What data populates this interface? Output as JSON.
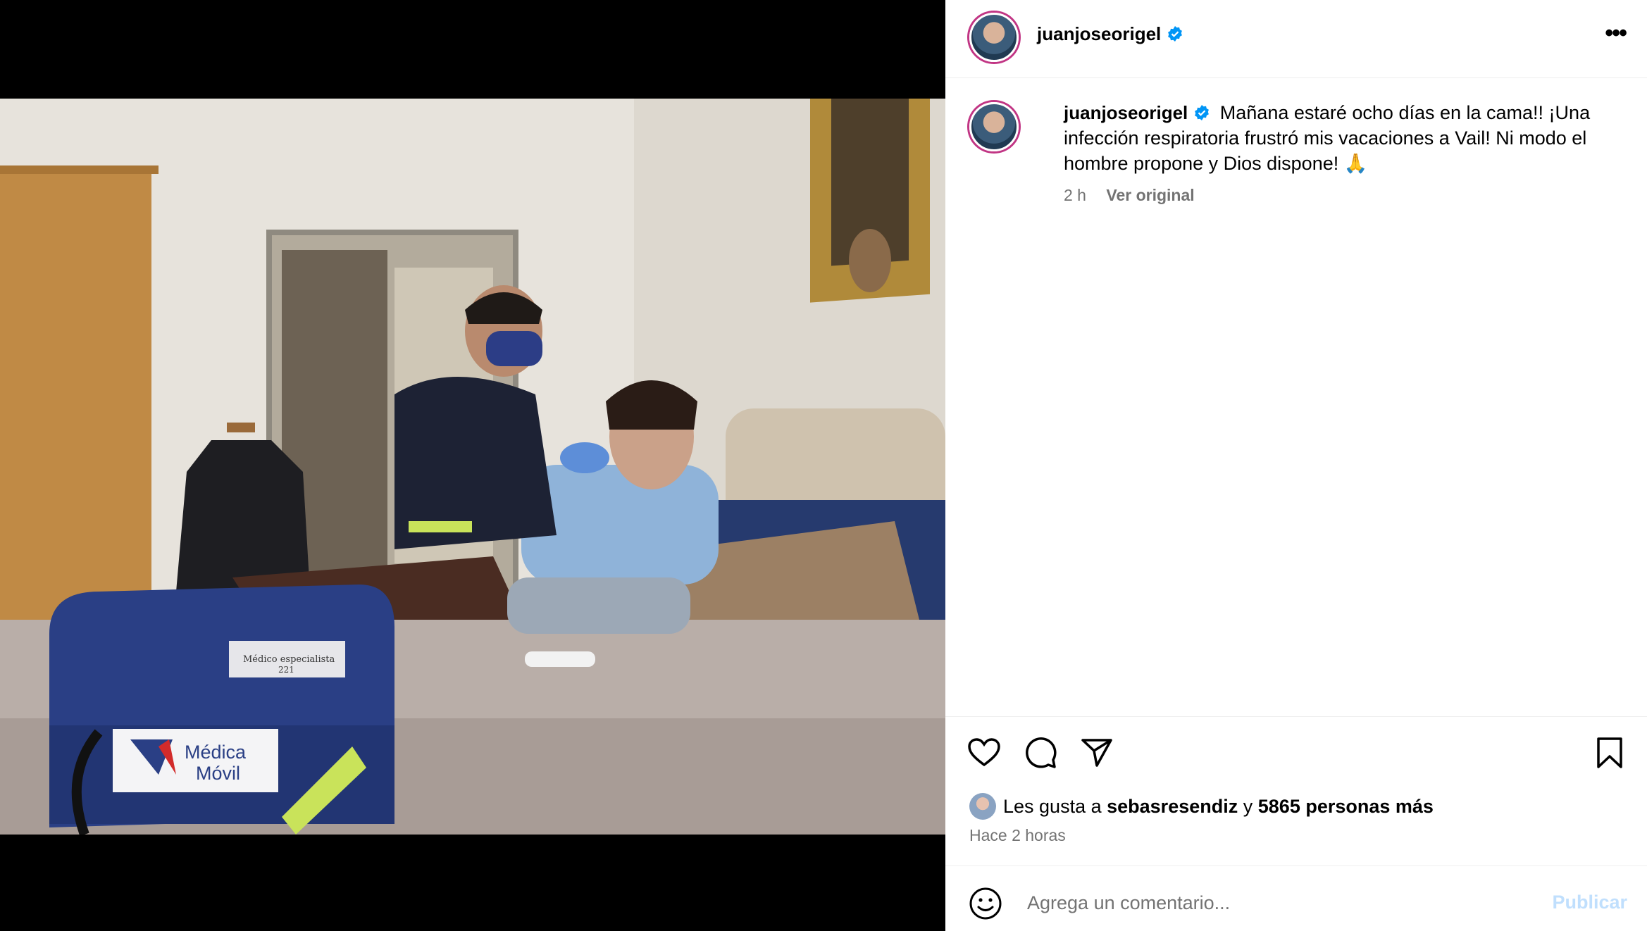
{
  "post": {
    "username": "juanjoseorigel",
    "verified": true,
    "caption": "Mañana estaré ocho días en la cama!! ¡Una infección respiratoria frustró mis vacaciones a Vail! Ni modo el hombre propone y Dios dispone! 🙏",
    "time_short": "2 h",
    "see_original": "Ver original",
    "likes_prefix": "Les gusta a",
    "likes_user": "sebasresendiz",
    "likes_conj": "y",
    "likes_others": "5865 personas más",
    "time_long": "Hace 2 horas"
  },
  "photo": {
    "bag_tag_line1": "Médico especialista",
    "bag_tag_line2": "221",
    "bag_logo_line1": "Médica",
    "bag_logo_line2": "Móvil"
  },
  "comment": {
    "placeholder": "Agrega un comentario...",
    "publish_label": "Publicar"
  },
  "icons": {
    "more": "more-options-icon",
    "like": "heart-icon",
    "comment": "comment-icon",
    "share": "share-icon",
    "save": "bookmark-icon",
    "emoji": "emoji-icon"
  },
  "colors": {
    "verified": "#0095f6",
    "publish_disabled": "#c0dffd",
    "muted_text": "#737373"
  }
}
